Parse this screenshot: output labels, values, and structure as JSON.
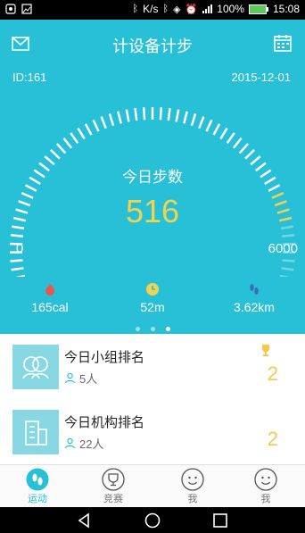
{
  "status_bar": {
    "network_speed": "K/s",
    "battery": "100%",
    "time": "15:08"
  },
  "header": {
    "title": "计设备计步",
    "id_label": "ID:161",
    "date": "2015-12-01",
    "today_steps_label": "今日步数",
    "steps_value": "516",
    "gauge_min": "0",
    "gauge_max": "6000",
    "gauge_level_fraction": 0.86,
    "accent_color": "#27c0d6",
    "steps_color": "#f2d24f"
  },
  "stats": {
    "calories": "165cal",
    "duration": "52m",
    "distance": "3.62km"
  },
  "rankings": [
    {
      "title": "今日小组排名",
      "count": "5人",
      "rank": "2"
    },
    {
      "title": "今日机构排名",
      "count": "22人",
      "rank": "2"
    }
  ],
  "tabs": [
    {
      "label": "运动",
      "icon": "footprint-icon",
      "active": true
    },
    {
      "label": "竞赛",
      "icon": "trophy-icon",
      "active": false
    },
    {
      "label": "我",
      "icon": "face-icon",
      "active": false
    },
    {
      "label": "我",
      "icon": "face-icon",
      "active": false
    }
  ]
}
